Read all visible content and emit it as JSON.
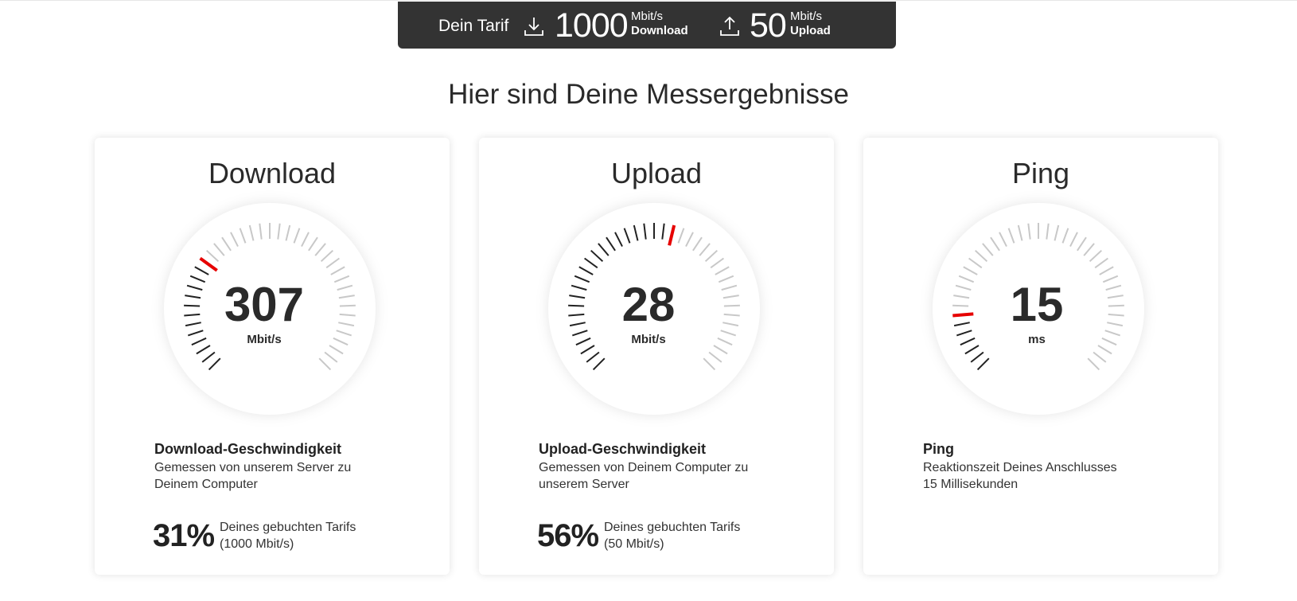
{
  "tariff": {
    "label": "Dein Tarif",
    "download_value": "1000",
    "download_unit": "Mbit/s",
    "download_label": "Download",
    "upload_value": "50",
    "upload_unit": "Mbit/s",
    "upload_label": "Upload",
    "download_icon": "download-arrow-icon",
    "upload_icon": "upload-arrow-icon"
  },
  "headline": "Hier sind Deine Messergebnisse",
  "colors": {
    "banner_bg": "#333333",
    "accent_red": "#e60000",
    "tick_active": "#222222",
    "tick_inactive": "#c8c8c8"
  },
  "cards": [
    {
      "title": "Download",
      "value": "307",
      "unit": "Mbit/s",
      "fraction": 0.31,
      "desc_title": "Download-Geschwindigkeit",
      "desc": "Gemessen von unserem Server zu Deinem Computer",
      "percent": "31%",
      "pct_note_line1": "Deines gebuchten Tarifs",
      "pct_note_line2": "(1000 Mbit/s)"
    },
    {
      "title": "Upload",
      "value": "28",
      "unit": "Mbit/s",
      "fraction": 0.56,
      "desc_title": "Upload-Geschwindigkeit",
      "desc": "Gemessen von Deinem Computer zu unserem Server",
      "percent": "56%",
      "pct_note_line1": "Deines gebuchten Tarifs",
      "pct_note_line2": "(50 Mbit/s)"
    },
    {
      "title": "Ping",
      "value": "15",
      "unit": "ms",
      "fraction": 0.15,
      "desc_title": "Ping",
      "desc_line1": "Reaktionszeit Deines Anschlusses",
      "desc_line2": "15 Millisekunden"
    }
  ]
}
